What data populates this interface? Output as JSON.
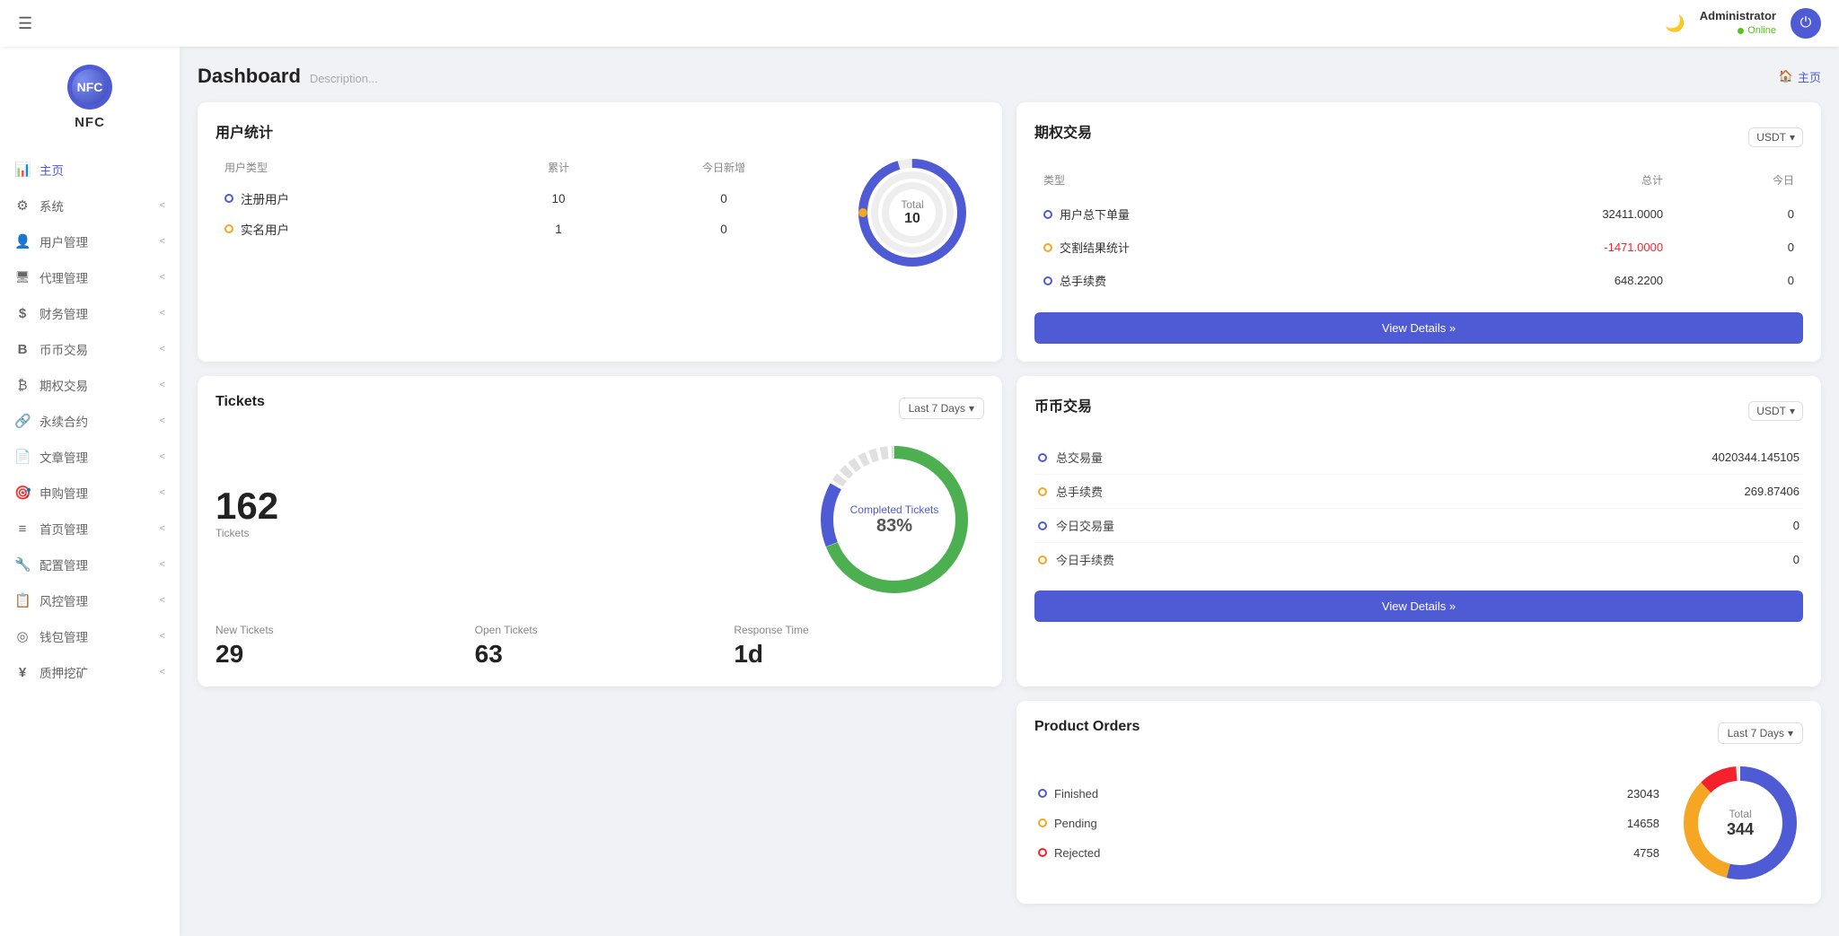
{
  "topbar": {
    "hamburger": "☰",
    "moon_icon": "🌙",
    "user_name": "Administrator",
    "user_status": "Online",
    "power_icon": "⏻"
  },
  "sidebar": {
    "logo_text": "NFC",
    "items": [
      {
        "id": "home",
        "icon": "📊",
        "label": "主页",
        "active": true,
        "arrow": ""
      },
      {
        "id": "system",
        "icon": "⚙",
        "label": "系统",
        "active": false,
        "arrow": "<"
      },
      {
        "id": "user-mgmt",
        "icon": "👤",
        "label": "用户管理",
        "active": false,
        "arrow": "<"
      },
      {
        "id": "agent-mgmt",
        "icon": "🖥",
        "label": "代理管理",
        "active": false,
        "arrow": "<"
      },
      {
        "id": "finance-mgmt",
        "icon": "$",
        "label": "财务管理",
        "active": false,
        "arrow": "<"
      },
      {
        "id": "coin-trade",
        "icon": "B",
        "label": "币币交易",
        "active": false,
        "arrow": "<"
      },
      {
        "id": "options-trade",
        "icon": "₿",
        "label": "期权交易",
        "active": false,
        "arrow": "<"
      },
      {
        "id": "perpetual",
        "icon": "🔗",
        "label": "永续合约",
        "active": false,
        "arrow": "<"
      },
      {
        "id": "article-mgmt",
        "icon": "📄",
        "label": "文章管理",
        "active": false,
        "arrow": "<"
      },
      {
        "id": "subscription-mgmt",
        "icon": "🎯",
        "label": "申购管理",
        "active": false,
        "arrow": "<"
      },
      {
        "id": "homepage-mgmt",
        "icon": "≡",
        "label": "首页管理",
        "active": false,
        "arrow": "<"
      },
      {
        "id": "config-mgmt",
        "icon": "🔧",
        "label": "配置管理",
        "active": false,
        "arrow": "<"
      },
      {
        "id": "risk-mgmt",
        "icon": "📋",
        "label": "风控管理",
        "active": false,
        "arrow": "<"
      },
      {
        "id": "wallet-mgmt",
        "icon": "◎",
        "label": "钱包管理",
        "active": false,
        "arrow": "<"
      },
      {
        "id": "mining",
        "icon": "¥",
        "label": "质押挖矿",
        "active": false,
        "arrow": "<"
      }
    ]
  },
  "page": {
    "title": "Dashboard",
    "description": "Description...",
    "home_link": "主页"
  },
  "user_stats": {
    "card_title": "用户统计",
    "headers": [
      "用户类型",
      "累计",
      "今日新增"
    ],
    "rows": [
      {
        "label": "注册用户",
        "dot_color": "blue",
        "total": "10",
        "today": "0"
      },
      {
        "label": "实名用户",
        "dot_color": "orange",
        "total": "1",
        "today": "0"
      }
    ],
    "chart": {
      "total_label": "Total",
      "total_num": "10"
    }
  },
  "tickets": {
    "card_title": "Tickets",
    "time_filter": "Last 7 Days",
    "count": "162",
    "count_label": "Tickets",
    "completed_label": "Completed Tickets",
    "pct": "83%",
    "stats": [
      {
        "label": "New Tickets",
        "value": "29"
      },
      {
        "label": "Open Tickets",
        "value": "63"
      },
      {
        "label": "Response Time",
        "value": "1d"
      }
    ]
  },
  "options_trading": {
    "card_title": "期权交易",
    "currency": "USDT",
    "headers": [
      "类型",
      "总计",
      "今日"
    ],
    "rows": [
      {
        "label": "用户总下单量",
        "dot_color": "blue",
        "total": "32411.0000",
        "today": "0"
      },
      {
        "label": "交割结果统计",
        "dot_color": "orange",
        "total": "-1471.0000",
        "today": "0",
        "neg": true
      },
      {
        "label": "总手续费",
        "dot_color": "blue",
        "total": "648.2200",
        "today": "0"
      }
    ],
    "view_btn": "View Details »"
  },
  "coin_trading": {
    "card_title": "币币交易",
    "currency": "USDT",
    "rows": [
      {
        "label": "总交易量",
        "value": "4020344.145105",
        "dot_color": "blue"
      },
      {
        "label": "总手续费",
        "value": "269.87406",
        "dot_color": "orange"
      },
      {
        "label": "今日交易量",
        "value": "0",
        "dot_color": "blue"
      },
      {
        "label": "今日手续费",
        "value": "0",
        "dot_color": "orange"
      }
    ],
    "view_btn": "View Details »"
  },
  "product_orders": {
    "card_title": "Product Orders",
    "time_filter": "Last 7 Days",
    "rows": [
      {
        "label": "Finished",
        "value": "23043",
        "dot_color": "blue"
      },
      {
        "label": "Pending",
        "value": "14658",
        "dot_color": "orange"
      },
      {
        "label": "Rejected",
        "value": "4758",
        "dot_color": "red"
      }
    ],
    "chart": {
      "total_label": "Total",
      "total_num": "344"
    }
  }
}
